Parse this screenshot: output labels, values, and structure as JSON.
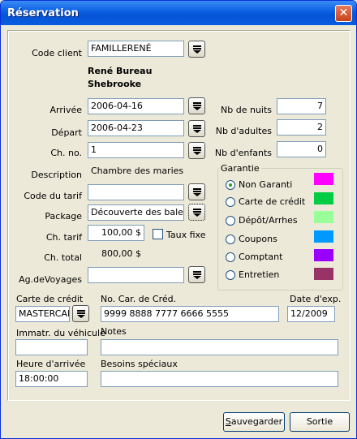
{
  "window": {
    "title": "Réservation",
    "close": "✕"
  },
  "client": {
    "label": "Code client",
    "value": "FAMILLERENÉ",
    "name": "René Bureau",
    "city": "Shebrooke"
  },
  "arrivee": {
    "label": "Arrivée",
    "value": "2006-04-16"
  },
  "depart": {
    "label": "Départ",
    "value": "2006-04-23"
  },
  "chno": {
    "label": "Ch. no.",
    "value": "1"
  },
  "description": {
    "label": "Description",
    "value": "Chambre des maries"
  },
  "code_tarif": {
    "label": "Code du tarif",
    "value": ""
  },
  "package": {
    "label": "Package",
    "value": "Découverte des baleines"
  },
  "ch_tarif": {
    "label": "Ch. tarif",
    "value": "100,00 $",
    "taux_fixe_label": "Taux fixe"
  },
  "ch_total": {
    "label": "Ch. total",
    "value": "800,00 $"
  },
  "ag_voyages": {
    "label": "Ag.deVoyages",
    "value": ""
  },
  "counts": {
    "nuits": {
      "label": "Nb de nuits",
      "value": "7"
    },
    "adultes": {
      "label": "Nb d'adultes",
      "value": "2"
    },
    "enfants": {
      "label": "Nb d'enfants",
      "value": "0"
    }
  },
  "garantie": {
    "title": "Garantie",
    "options": [
      {
        "label": "Non Garanti",
        "color": "#ff00ff",
        "selected": true
      },
      {
        "label": "Carte de crédit",
        "color": "#00cc44",
        "selected": false
      },
      {
        "label": "Dépôt/Arrhes",
        "color": "#99ff99",
        "selected": false
      },
      {
        "label": "Coupons",
        "color": "#0099ff",
        "selected": false
      },
      {
        "label": "Comptant",
        "color": "#9900ff",
        "selected": false
      },
      {
        "label": "Entretien",
        "color": "#993366",
        "selected": false
      }
    ]
  },
  "carte_credit": {
    "label": "Carte de crédit",
    "value": "MASTERCARD"
  },
  "no_carte": {
    "label": "No. Car. de Créd.",
    "value": "9999 8888 7777 6666 5555"
  },
  "date_exp": {
    "label": "Date d'exp.",
    "value": "12/2009"
  },
  "immatr": {
    "label": "Immatr. du véhicule",
    "value": ""
  },
  "notes": {
    "label": "Notes",
    "value": ""
  },
  "heure": {
    "label": "Heure d'arrivée",
    "value": "18:00:00"
  },
  "besoins": {
    "label": "Besoins spéciaux",
    "value": ""
  },
  "buttons": {
    "save": "Sauvegarder",
    "exit": "Sortie"
  }
}
